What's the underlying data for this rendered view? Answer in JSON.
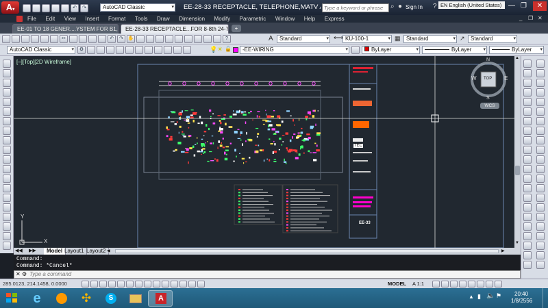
{
  "window": {
    "title": "EE-28-33 RECEPTACLE, TELEPHONE,MATV AND ...",
    "search_placeholder": "Type a keyword or phrase",
    "sign_in": "Sign In",
    "language": "EN English (United States)",
    "workspace": "AutoCAD Classic"
  },
  "menu": [
    "File",
    "Edit",
    "View",
    "Insert",
    "Format",
    "Tools",
    "Draw",
    "Dimension",
    "Modify",
    "Parametric",
    "Window",
    "Help",
    "Express"
  ],
  "doc_tabs": [
    {
      "label": "EE-01 TO 18  GENER....YSTEM FOR B1,B2,B3*",
      "active": false
    },
    {
      "label": "EE-28-33 RECEPTACLE...FOR 8-8th 24-7-56*",
      "active": true
    }
  ],
  "toolbar1": {
    "text_style": "Standard",
    "dim_style": "KU-100-1",
    "table_style": "Standard",
    "mleader_style": "Standard"
  },
  "toolbar2": {
    "workspace": "AutoCAD Classic",
    "layer": "-EE-WIRING",
    "color": "ByLayer",
    "linetype": "ByLayer",
    "lineweight": "ByLayer"
  },
  "viewport_label": "[–][Top][2D Wireframe]",
  "viewcube": {
    "top": "TOP",
    "n": "N",
    "s": "S",
    "e": "E",
    "w": "W",
    "wcs": "WCS"
  },
  "ucs": {
    "x": "X",
    "y": "Y"
  },
  "layout_tabs": [
    "Model",
    "Layout1",
    "Layout2"
  ],
  "command_history": [
    "Command:",
    "Command: *Cancel*"
  ],
  "command_placeholder": "Type a command",
  "status": {
    "coords": "285.0123, 214.1458, 0.0000",
    "model": "MODEL",
    "scale": "A 1:1"
  },
  "drawing": {
    "title_code": "EE-33",
    "tag": "TEC"
  },
  "clock": {
    "time": "20:40",
    "date": "1/8/2556"
  },
  "colors": {
    "accent_red": "#d1242a",
    "canvas_bg": "#212830",
    "taskbar": "#1f5878"
  }
}
